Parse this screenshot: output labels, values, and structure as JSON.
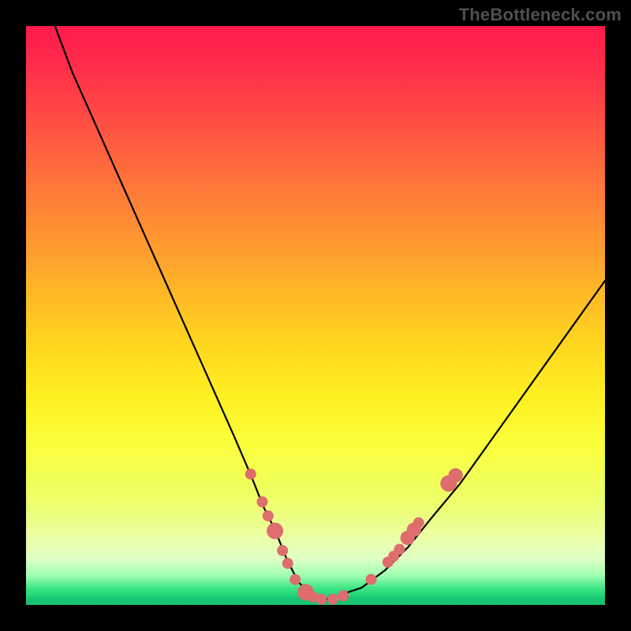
{
  "watermark": "TheBottleneck.com",
  "chart_data": {
    "type": "line",
    "title": "",
    "xlabel": "",
    "ylabel": "",
    "xlim": [
      0,
      100
    ],
    "ylim": [
      0,
      100
    ],
    "grid": false,
    "legend": false,
    "series": [
      {
        "name": "bottleneck-curve",
        "x": [
          5,
          8,
          12,
          16,
          20,
          24,
          28,
          32,
          36,
          39,
          41,
          43,
          45,
          47,
          49,
          51,
          53,
          55,
          58,
          62,
          66,
          70,
          75,
          80,
          85,
          90,
          95,
          100
        ],
        "y": [
          100,
          92,
          83,
          74,
          65,
          56,
          47,
          38,
          29,
          22,
          17,
          13,
          8,
          4,
          2,
          1,
          1,
          2,
          3,
          6,
          10,
          15,
          21,
          28,
          35,
          42,
          49,
          56
        ]
      }
    ],
    "markers": {
      "name": "highlight-points",
      "color": "#de6d6e",
      "points": [
        {
          "x": 38.8,
          "y": 22.6,
          "r": 1.0
        },
        {
          "x": 40.8,
          "y": 17.8,
          "r": 1.0
        },
        {
          "x": 41.8,
          "y": 15.4,
          "r": 1.0
        },
        {
          "x": 43.0,
          "y": 12.8,
          "r": 1.5
        },
        {
          "x": 44.3,
          "y": 9.4,
          "r": 1.0
        },
        {
          "x": 45.2,
          "y": 7.2,
          "r": 1.0
        },
        {
          "x": 46.5,
          "y": 4.4,
          "r": 1.0
        },
        {
          "x": 48.3,
          "y": 2.2,
          "r": 1.5
        },
        {
          "x": 49.6,
          "y": 1.4,
          "r": 1.0
        },
        {
          "x": 51.0,
          "y": 1.0,
          "r": 1.0
        },
        {
          "x": 53.0,
          "y": 1.0,
          "r": 1.0
        },
        {
          "x": 54.8,
          "y": 1.6,
          "r": 1.0
        },
        {
          "x": 59.6,
          "y": 4.4,
          "r": 1.0
        },
        {
          "x": 62.5,
          "y": 7.4,
          "r": 1.0
        },
        {
          "x": 63.5,
          "y": 8.4,
          "r": 1.0
        },
        {
          "x": 64.5,
          "y": 9.6,
          "r": 1.0
        },
        {
          "x": 65.9,
          "y": 11.6,
          "r": 1.3
        },
        {
          "x": 67.0,
          "y": 13.0,
          "r": 1.3
        },
        {
          "x": 67.8,
          "y": 14.2,
          "r": 1.0
        },
        {
          "x": 73.0,
          "y": 21.0,
          "r": 1.5
        },
        {
          "x": 74.2,
          "y": 22.4,
          "r": 1.3
        }
      ]
    },
    "annotations": [
      {
        "text": "TheBottleneck.com",
        "position": "top-right"
      }
    ]
  }
}
